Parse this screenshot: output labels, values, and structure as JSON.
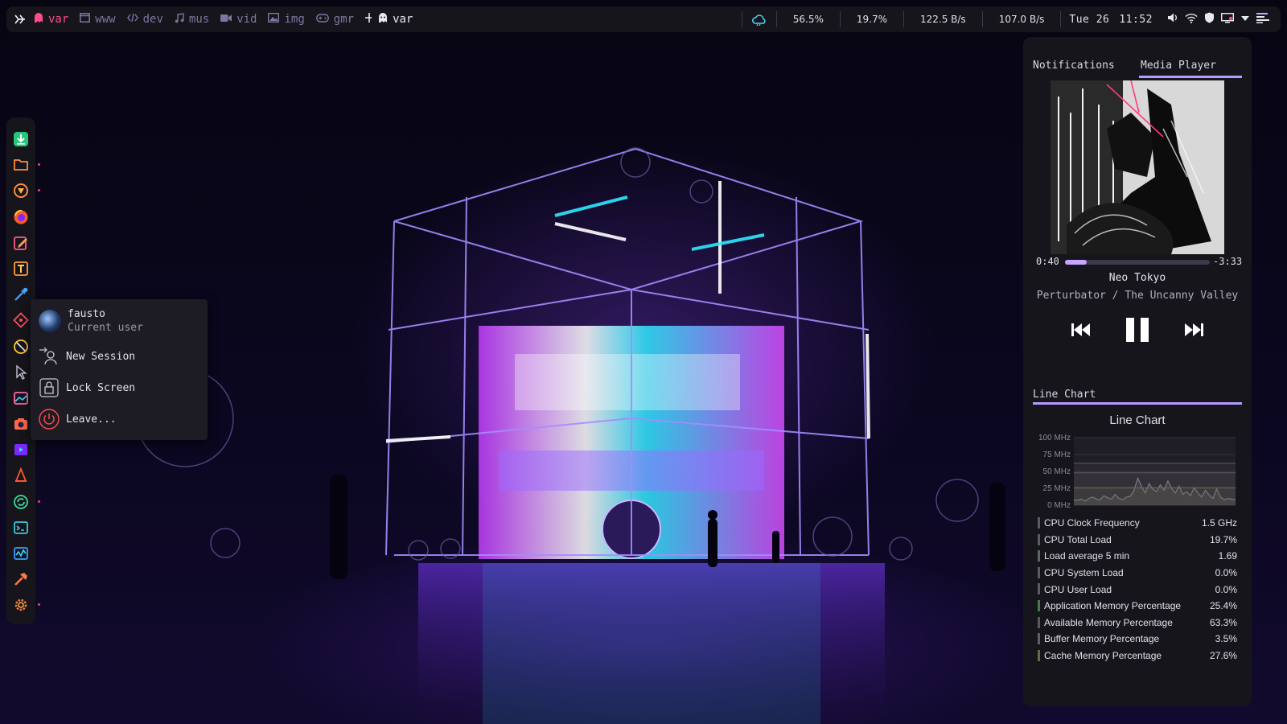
{
  "topbar": {
    "workspaces": [
      {
        "icon": "ghost-icon",
        "label": "var",
        "active": true
      },
      {
        "icon": "window-icon",
        "label": "www",
        "active": false
      },
      {
        "icon": "code-icon",
        "label": "dev",
        "active": false
      },
      {
        "icon": "music-icon",
        "label": "mus",
        "active": false
      },
      {
        "icon": "video-icon",
        "label": "vid",
        "active": false
      },
      {
        "icon": "image-icon",
        "label": "img",
        "active": false
      },
      {
        "icon": "gamepad-icon",
        "label": "gmr",
        "active": false
      }
    ],
    "current_window": {
      "icon": "ghost-icon",
      "label": "var"
    },
    "cpu_percent": "56.5%",
    "load_percent": "19.7%",
    "net_down": "122.5 B/s",
    "net_up": "107.0 B/s",
    "date": "Tue 26",
    "time": "11:52",
    "tray": [
      "weather-icon",
      "volume-icon",
      "wifi-icon",
      "shield-icon",
      "display-icon",
      "chevron-down-icon",
      "menu-icon"
    ]
  },
  "dock": {
    "items": [
      {
        "name": "download-app",
        "color": "#3ad98a",
        "running": false
      },
      {
        "name": "file-manager",
        "color": "#ff8a3d",
        "running": true
      },
      {
        "name": "brave-browser",
        "color": "#ff8a3d",
        "running": true
      },
      {
        "name": "firefox",
        "color": "#ff6b2d",
        "running": false
      },
      {
        "name": "text-editor",
        "color": "#ff5a8a",
        "running": false
      },
      {
        "name": "typora",
        "color": "#ff9a3d",
        "running": false
      },
      {
        "name": "color-picker",
        "color": "#4aa3ff",
        "running": false
      },
      {
        "name": "git-client",
        "color": "#ff5a5a",
        "running": false
      },
      {
        "name": "clock-app",
        "color": "#ffcc33",
        "running": false
      },
      {
        "name": "pointer-app",
        "color": "#b0b0c0",
        "running": false
      },
      {
        "name": "image-viewer",
        "color": "#ff6ab0",
        "running": false
      },
      {
        "name": "screenshot-app",
        "color": "#ff6a4a",
        "running": false
      },
      {
        "name": "video-editor",
        "color": "#b04aff",
        "running": false
      },
      {
        "name": "vlc",
        "color": "#ff5533",
        "running": false
      },
      {
        "name": "sync-app",
        "color": "#3ad9a0",
        "running": true
      },
      {
        "name": "terminal",
        "color": "#3ac8e0",
        "running": false
      },
      {
        "name": "system-monitor",
        "color": "#3a9aff",
        "running": false
      },
      {
        "name": "build-tool",
        "color": "#ff7a4a",
        "running": false
      },
      {
        "name": "settings",
        "color": "#ff7a4a",
        "running": true
      }
    ]
  },
  "session_menu": {
    "user": "fausto",
    "user_sub": "Current user",
    "new_session": "New Session",
    "lock_screen": "Lock Screen",
    "leave": "Leave..."
  },
  "panel": {
    "tab_notifications": "Notifications",
    "tab_media": "Media Player",
    "player": {
      "elapsed": "0:40",
      "remaining": "-3:33",
      "progress": 0.15,
      "title": "Neo Tokyo",
      "artist_album": "Perturbator / The Uncanny Valley",
      "state": "playing"
    },
    "chart_tab": "Line Chart",
    "stats": [
      {
        "label": "CPU Clock Frequency",
        "value": "1.5 GHz",
        "color": "#5a5a6a"
      },
      {
        "label": "CPU Total Load",
        "value": "19.7%",
        "color": "#5a5a6a"
      },
      {
        "label": "Load average 5 min",
        "value": "1.69",
        "color": "#5a6a5a"
      },
      {
        "label": "CPU System Load",
        "value": "0.0%",
        "color": "#5a5a6a"
      },
      {
        "label": "CPU User Load",
        "value": "0.0%",
        "color": "#5a5a6a"
      },
      {
        "label": "Application Memory Percentage",
        "value": "25.4%",
        "color": "#4a7a4a"
      },
      {
        "label": "Available Memory Percentage",
        "value": "63.3%",
        "color": "#5a5a5a"
      },
      {
        "label": "Buffer Memory Percentage",
        "value": "3.5%",
        "color": "#6a5a6a"
      },
      {
        "label": "Cache Memory Percentage",
        "value": "27.6%",
        "color": "#6a6a4a"
      }
    ]
  },
  "chart_data": {
    "type": "line",
    "title": "Line Chart",
    "ylabel": "",
    "xlabel": "",
    "yticks": [
      "100 MHz",
      "75 MHz",
      "50 MHz",
      "25 MHz",
      "0 MHz"
    ],
    "ylim": [
      0,
      100
    ],
    "grid": true,
    "series": [
      {
        "values": [
          8,
          7,
          9,
          6,
          10,
          12,
          9,
          8,
          14,
          11,
          9,
          16,
          10,
          8,
          12,
          13,
          22,
          40,
          28,
          18,
          32,
          24,
          20,
          30,
          22,
          36,
          25,
          18,
          28,
          16,
          20,
          14,
          26,
          18,
          12,
          22,
          15,
          10,
          24,
          12,
          8,
          10,
          9,
          8
        ],
        "color": "#8a8a9a"
      },
      {
        "values": [
          48,
          48,
          48,
          48,
          48,
          48,
          48,
          48,
          48,
          48,
          48,
          48,
          48,
          48,
          48,
          48,
          48,
          48,
          48,
          48,
          48,
          48,
          48,
          48,
          48,
          48,
          48,
          48,
          48,
          48,
          48,
          48,
          48,
          48,
          48,
          48,
          48,
          48,
          48,
          48,
          48,
          48,
          48,
          48
        ],
        "color": "#6a5a6a"
      },
      {
        "values": [
          62,
          62,
          62,
          62,
          62,
          62,
          62,
          62,
          62,
          62,
          62,
          62,
          62,
          62,
          62,
          62,
          62,
          62,
          62,
          62,
          62,
          62,
          62,
          62,
          62,
          62,
          62,
          62,
          62,
          62,
          62,
          62,
          62,
          62,
          62,
          62,
          62,
          62,
          62,
          62,
          62,
          62,
          62,
          62
        ],
        "color": "#5a5a5a"
      },
      {
        "values": [
          26,
          26,
          26,
          26,
          26,
          26,
          26,
          26,
          26,
          26,
          26,
          26,
          26,
          26,
          26,
          26,
          26,
          26,
          26,
          26,
          26,
          26,
          26,
          26,
          26,
          26,
          26,
          26,
          26,
          26,
          26,
          26,
          26,
          26,
          26,
          26,
          26,
          26,
          26,
          26,
          26,
          26,
          26,
          26
        ],
        "color": "#6a6a4a"
      }
    ]
  }
}
